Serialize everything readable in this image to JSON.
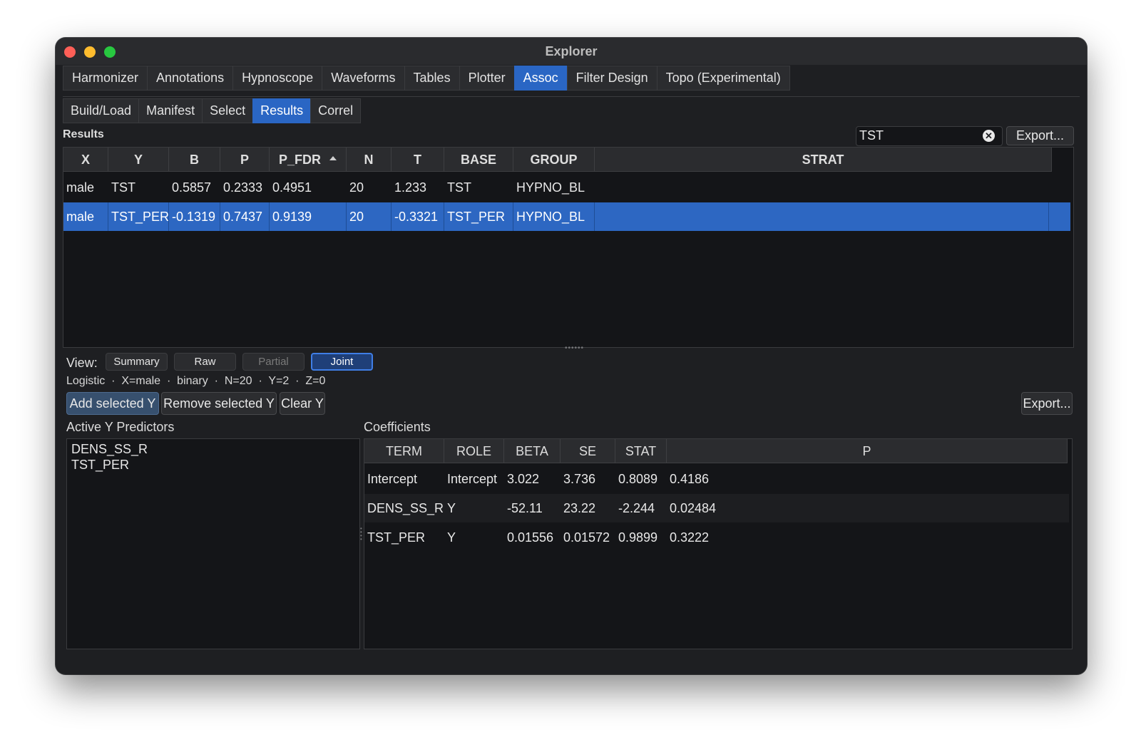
{
  "window": {
    "title": "Explorer"
  },
  "main_tabs": [
    "Harmonizer",
    "Annotations",
    "Hypnoscope",
    "Waveforms",
    "Tables",
    "Plotter",
    "Assoc",
    "Filter Design",
    "Topo (Experimental)"
  ],
  "main_tab_active": "Assoc",
  "sub_tabs": [
    "Build/Load",
    "Manifest",
    "Select",
    "Results",
    "Correl"
  ],
  "sub_tab_active": "Results",
  "results": {
    "label": "Results",
    "search_value": "TST",
    "export_label": "Export...",
    "columns": [
      "X",
      "Y",
      "B",
      "P",
      "P_FDR",
      "N",
      "T",
      "BASE",
      "GROUP",
      "STRAT"
    ],
    "sort_column": "P_FDR",
    "sort_direction": "ascending",
    "rows": [
      [
        "male",
        "TST",
        "0.5857",
        "0.2333",
        "0.4951",
        "20",
        "1.233",
        "TST",
        "HYPNO_BL",
        ""
      ],
      [
        "male",
        "TST_PER",
        "-0.1319",
        "0.7437",
        "0.9139",
        "20",
        "-0.3321",
        "TST_PER",
        "HYPNO_BL",
        ""
      ]
    ],
    "selected_row": 1
  },
  "view": {
    "label": "View:",
    "options": [
      "Summary",
      "Raw",
      "Partial",
      "Joint"
    ],
    "active": "Joint",
    "disabled": [
      "Partial"
    ]
  },
  "model_info": "Logistic  ·  X=male  ·  binary  ·  N=20  ·  Y=2  ·  Z=0",
  "actions": {
    "add_selected_y": "Add selected Y",
    "remove_selected_y": "Remove selected Y",
    "clear_y": "Clear Y",
    "export": "Export..."
  },
  "active_predictors": {
    "label": "Active Y Predictors",
    "items": [
      "DENS_SS_R",
      "TST_PER"
    ]
  },
  "coefficients": {
    "label": "Coefficients",
    "columns": [
      "TERM",
      "ROLE",
      "BETA",
      "SE",
      "STAT",
      "P"
    ],
    "rows": [
      [
        "Intercept",
        "Intercept",
        "3.022",
        "3.736",
        "0.8089",
        "0.4186"
      ],
      [
        "DENS_SS_R",
        "Y",
        "-52.11",
        "23.22",
        "-2.244",
        "0.02484"
      ],
      [
        "TST_PER",
        "Y",
        "0.01556",
        "0.01572",
        "0.9899",
        "0.3222"
      ]
    ]
  },
  "colors": {
    "accent": "#2a66c4",
    "window_bg": "#1e1f22",
    "table_bg": "#141518",
    "close": "#fe5f57",
    "minimize": "#febc2e",
    "zoom": "#28c840"
  }
}
